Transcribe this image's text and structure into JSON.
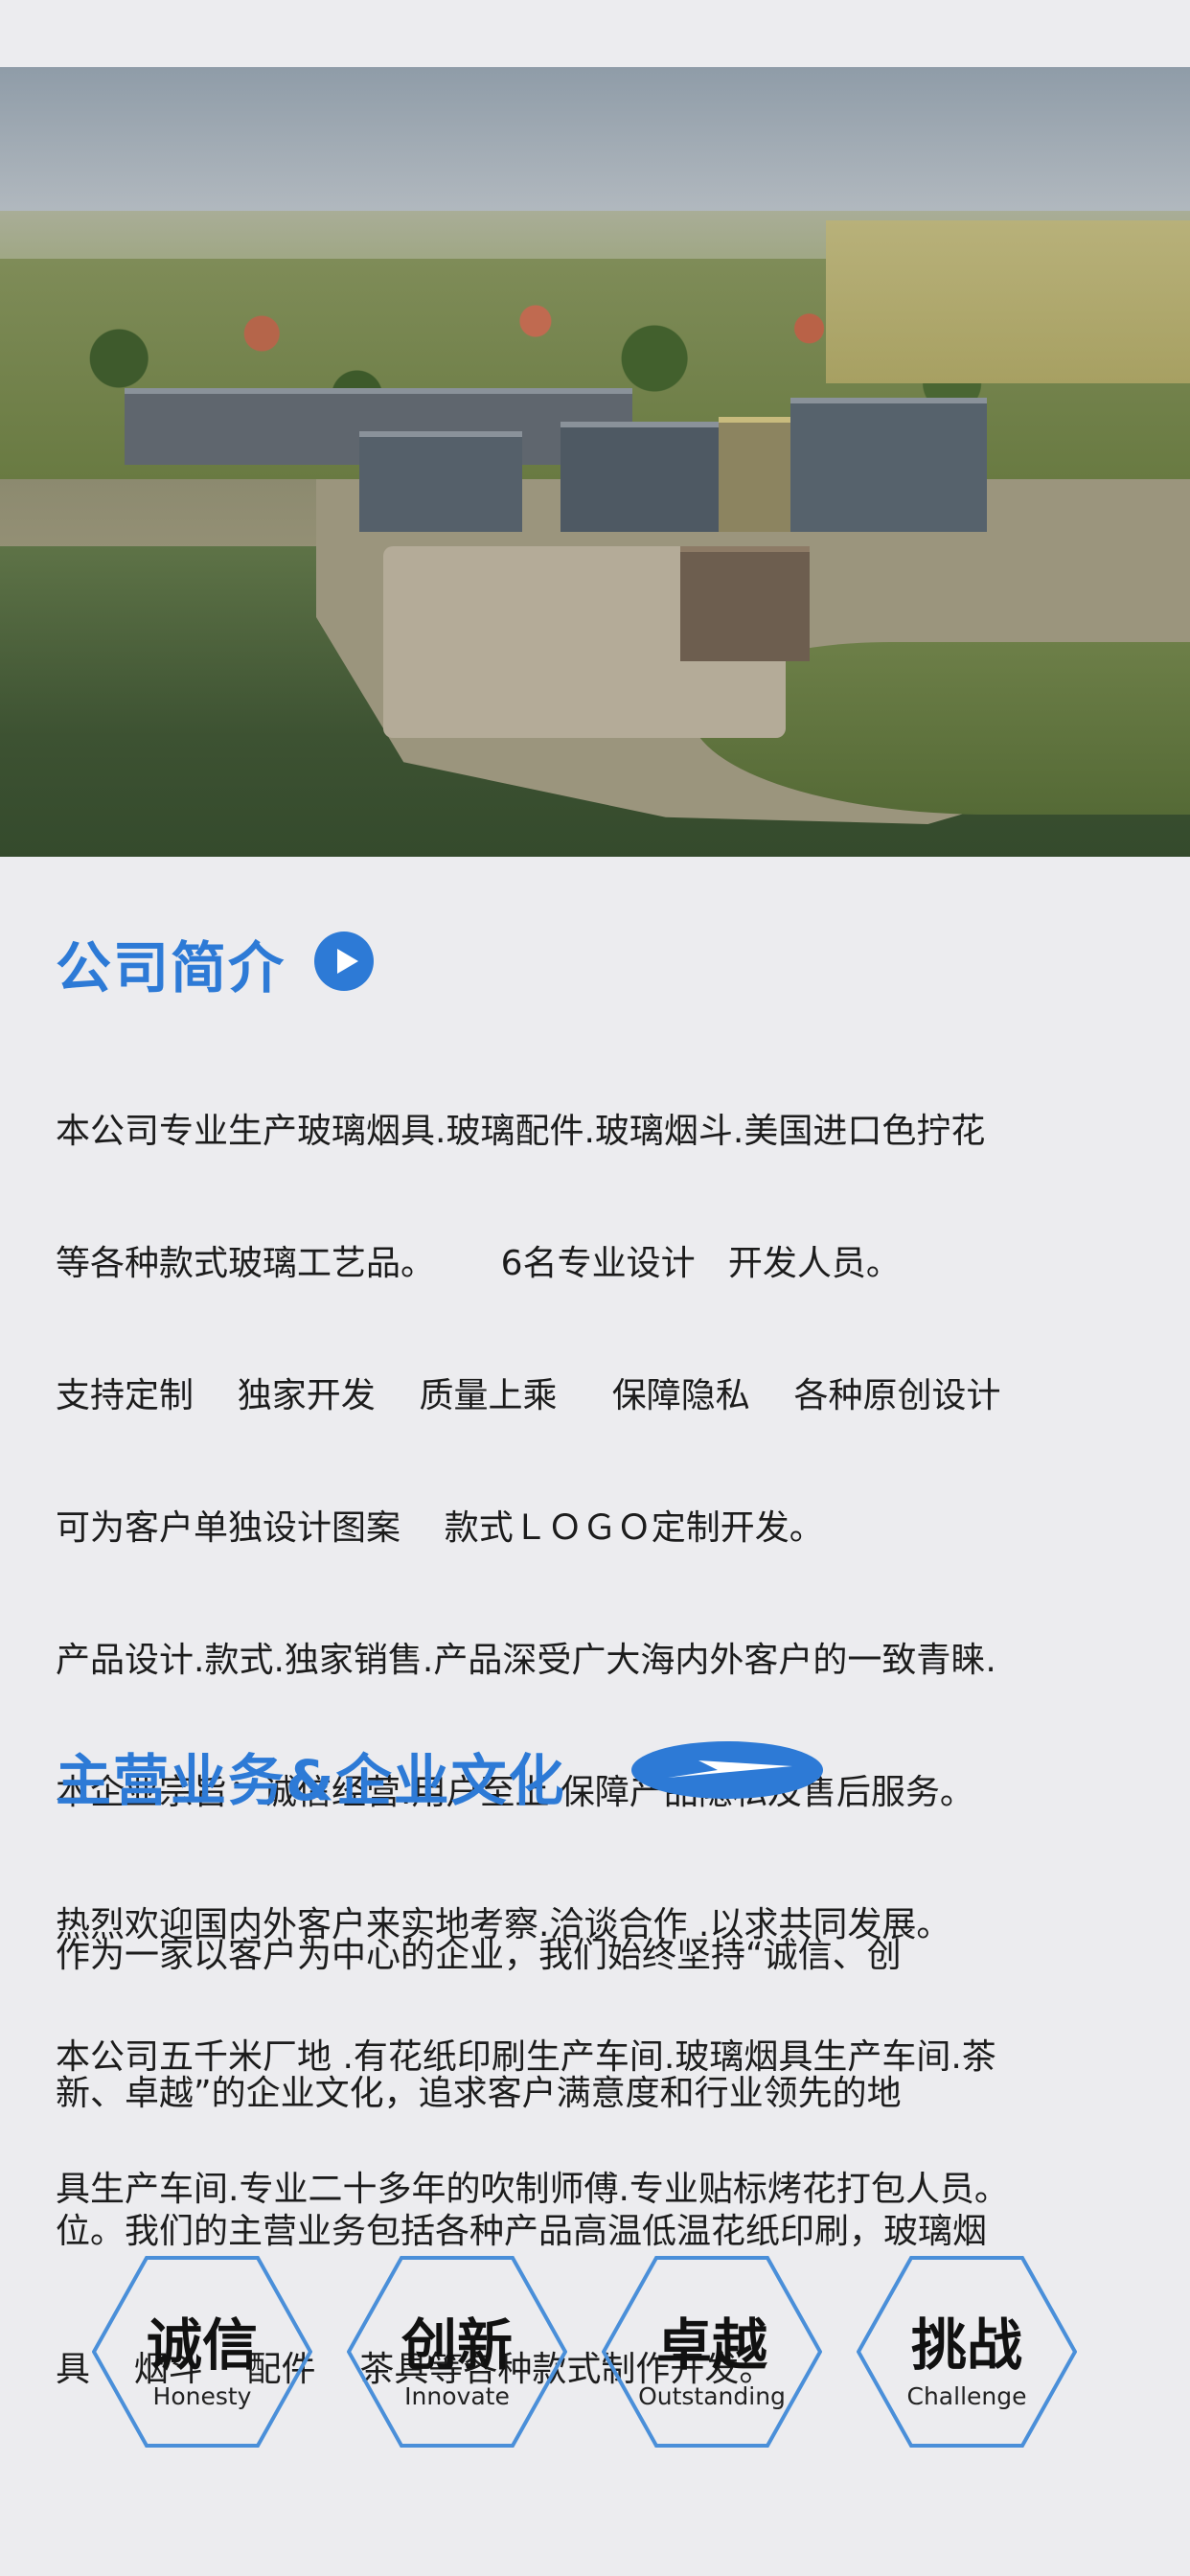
{
  "hero": {
    "image": "factory-aerial-photo"
  },
  "intro": {
    "title": "公司简介",
    "icon": "play-arrow-icon",
    "lines": [
      "本公司专业生产玻璃烟具.玻璃配件.玻璃烟斗.美国进口色拧花",
      "等各种款式玻璃工艺品。      6名专业设计   开发人员。",
      "支持定制    独家开发    质量上乘     保障隐私    各种原创设计",
      "可为客户单独设计图案    款式ＬＯＧＯ定制开发。",
      "产品设计.款式.独家销售.产品深受广大海内外客户的一致青睐.",
      "本企业宗旨：诚信经营.用户至上.保障产品隐私及售后服务。",
      "热烈欢迎国内外客户来实地考察.洽谈合作 .以求共同发展。",
      "本公司五千米厂地 .有花纸印刷生产车间.玻璃烟具生产车间.茶",
      "具生产车间.专业二十多年的吹制师傅.专业贴标烤花打包人员。"
    ]
  },
  "business": {
    "title": "主营业务&企业文化",
    "icon": "paper-plane-icon",
    "lines": [
      "作为一家以客户为中心的企业，我们始终坚持“诚信、创",
      "新、卓越”的企业文化，追求客户满意度和行业领先的地",
      "位。我们的主营业务包括各种产品高温低温花纸印刷，玻璃烟",
      "具    烟斗    配件    茶具等各种款式制作开发。"
    ]
  },
  "values": [
    {
      "cn": "诚信",
      "en": "Honesty"
    },
    {
      "cn": "创新",
      "en": "Innovate"
    },
    {
      "cn": "卓越",
      "en": "Outstanding"
    },
    {
      "cn": "挑战",
      "en": "Challenge"
    }
  ],
  "colors": {
    "accent": "#2d7ad6",
    "hex_stroke": "#4a8fd9",
    "background": "#ececef"
  }
}
